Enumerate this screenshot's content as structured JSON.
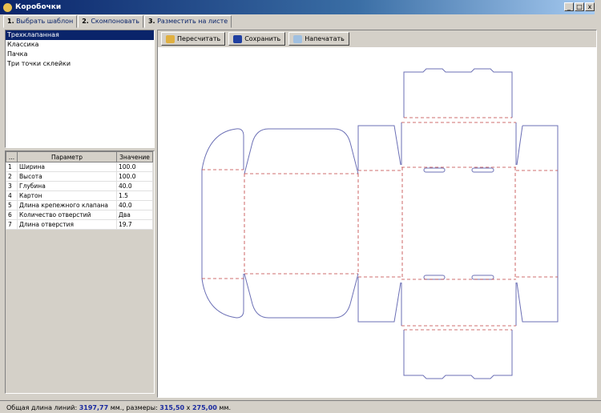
{
  "window": {
    "title": "Коробочки",
    "minimize": "_",
    "maximize": "□",
    "close": "x"
  },
  "tabs": [
    {
      "num": "1.",
      "label": "Выбрать шаблон"
    },
    {
      "num": "2.",
      "label": "Скомпоновать"
    },
    {
      "num": "3.",
      "label": "Разместить на листе"
    }
  ],
  "templates": [
    "Трехклапанная",
    "Классика",
    "Пачка",
    "Три точки склейки"
  ],
  "selected_template": "Трехклапанная",
  "params": {
    "headers": [
      "...",
      "Параметр",
      "Значение"
    ],
    "rows": [
      [
        "1",
        "Ширина",
        "100.0"
      ],
      [
        "2",
        "Высота",
        "100.0"
      ],
      [
        "3",
        "Глубина",
        "40.0"
      ],
      [
        "4",
        "Картон",
        "1.5"
      ],
      [
        "5",
        "Длина крепежного клапана",
        "40.0"
      ],
      [
        "6",
        "Количество отверстий",
        "Два"
      ],
      [
        "7",
        "Длина отверстия",
        "19.7"
      ]
    ]
  },
  "toolbar": {
    "recalc": "Пересчитать",
    "save": "Сохранить",
    "print": "Напечатать"
  },
  "status": {
    "prefix": "Общая длина линий:",
    "length": "3197,77",
    "unit1": "мм., размеры:",
    "w": "315,50",
    "x": "x",
    "h": "275,00",
    "unit2": "мм."
  },
  "colors": {
    "cut_line": "#6b6fb5",
    "fold_line": "#c04040",
    "selection": "#0a246a"
  }
}
